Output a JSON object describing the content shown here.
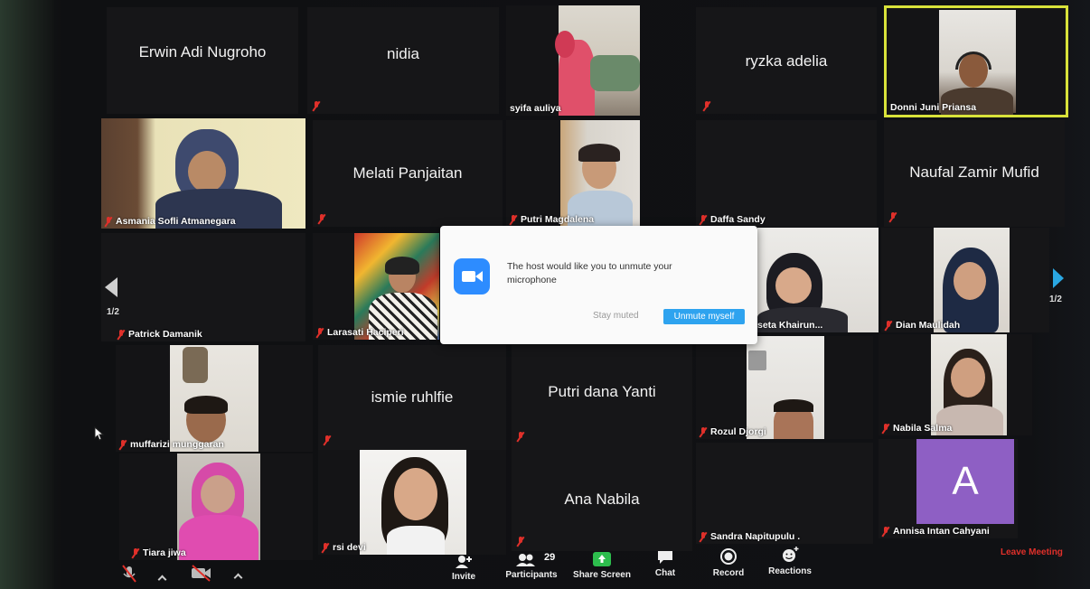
{
  "meeting": {
    "page_indicator_left": "1/2",
    "page_indicator_right": "1/2"
  },
  "participants": {
    "erwin": "Erwin Adi Nugroho",
    "nidia": "nidia",
    "syifa": "syifa auliya",
    "ryzka": "ryzka adelia",
    "donni": "Donni Juni Priansa",
    "asmania": "Asmania Sofli Atmanegara",
    "melati": "Melati Panjaitan",
    "putri_m": "Putri Magdalena",
    "daffa": "Daffa Sandy",
    "naufal": "Naufal Zamir Mufid",
    "patrick": "Patrick Damanik",
    "larasati": "Larasati Haciperi",
    "seta": "seta Khairun...",
    "dian": "Dian Maulidah",
    "muffarizi": "muffarizi munggaran",
    "ismie": "ismie ruhlfie",
    "putri_d": "Putri dana Yanti",
    "rozul": "Rozul Djorgi",
    "nabila_s": "Nabila Salma",
    "tiara": "Tiara jiwa",
    "rsi": "rsi devi",
    "ana": "Ana Nabila",
    "sandra": "Sandra Napitupulu .",
    "annisa": "Annisa Intan Cahyani",
    "annisa_initial": "A"
  },
  "dialog": {
    "message": "The host would like you to unmute your microphone",
    "stay_label": "Stay muted",
    "unmute_label": "Unmute myself"
  },
  "toolbar": {
    "invite": "Invite",
    "participants": "Participants",
    "participants_count": "29",
    "share": "Share Screen",
    "chat": "Chat",
    "record": "Record",
    "reactions": "Reactions",
    "leave": "Leave Meeting"
  },
  "colors": {
    "zoom_blue": "#2d8cff",
    "active_speaker": "#d8e23a",
    "muted_red": "#e0302a",
    "avatar_purple": "#8e5fc4",
    "share_green": "#2dbd4d"
  },
  "icons": {
    "muted": "mic-off-icon",
    "invite": "add-person-icon",
    "participants": "people-icon",
    "share": "share-screen-icon",
    "chat": "chat-bubble-icon",
    "record": "record-icon",
    "reactions": "smiley-plus-icon"
  }
}
